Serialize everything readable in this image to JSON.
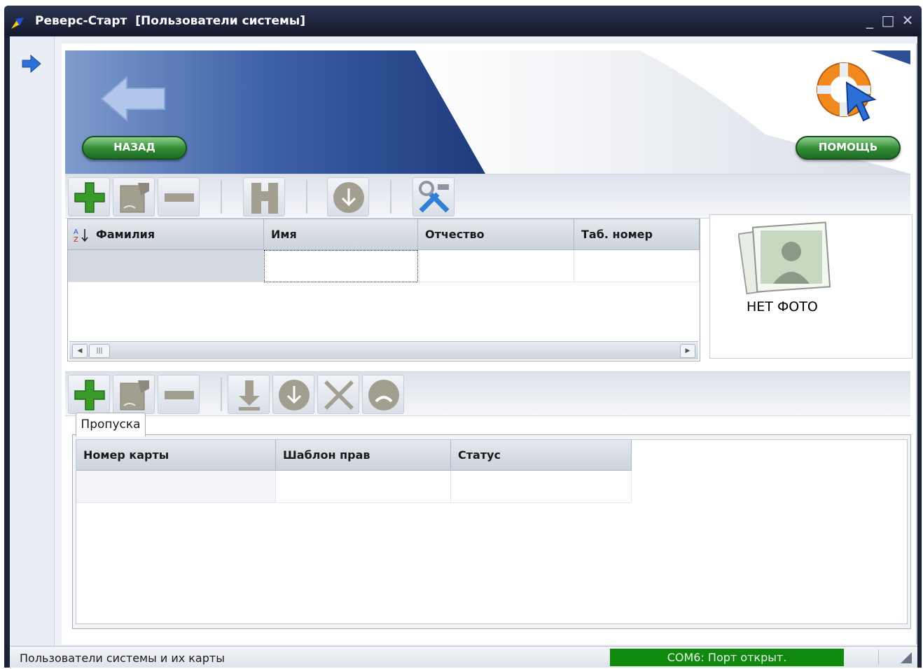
{
  "window": {
    "title": "Реверс-Старт  [Пользователи системы]",
    "minimize": "_",
    "maximize": "□",
    "close": "✕"
  },
  "banner": {
    "back_label": "НАЗАД",
    "help_label": "ПОМОЩЬ"
  },
  "users_toolbar": {
    "icons": [
      "plus-icon",
      "edit-icon",
      "minus-icon",
      "binoculars-icon",
      "download-icon",
      "tools-icon"
    ]
  },
  "users_table": {
    "columns": [
      "Фамилия",
      "Имя",
      "Отчество",
      "Таб. номер"
    ],
    "sort_indicator": "A-Z"
  },
  "photo": {
    "label": "НЕТ ФОТО"
  },
  "cards_toolbar": {
    "icons": [
      "plus-icon",
      "edit-icon",
      "minus-icon",
      "arrow-down-icon",
      "download-icon",
      "delete-icon",
      "block-icon"
    ]
  },
  "tabs": [
    {
      "label": "Пропуска",
      "active": true
    }
  ],
  "cards_table": {
    "columns": [
      "Номер карты",
      "Шаблон прав",
      "Статус"
    ]
  },
  "status": {
    "text": "Пользователи системы и их карты",
    "port": "COM6: Порт открыт.",
    "port_color": "#0f8a0f"
  },
  "colors": {
    "title_bg": "#1c2235",
    "banner_blue": "#2d4f94",
    "accent_green": "#2f8a33"
  }
}
